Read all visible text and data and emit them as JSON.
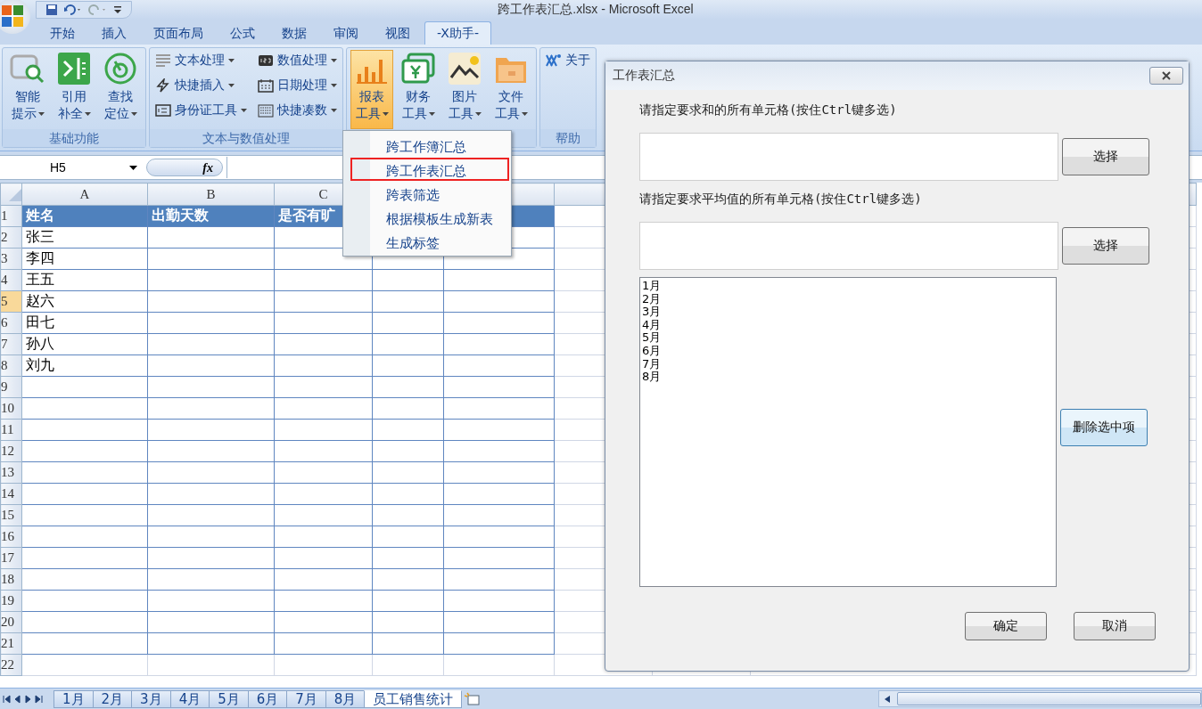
{
  "window": {
    "title": "跨工作表汇总.xlsx - Microsoft Excel"
  },
  "ribbon_tabs": [
    {
      "label": "开始",
      "selected": false
    },
    {
      "label": "插入",
      "selected": false
    },
    {
      "label": "页面布局",
      "selected": false
    },
    {
      "label": "公式",
      "selected": false
    },
    {
      "label": "数据",
      "selected": false
    },
    {
      "label": "审阅",
      "selected": false
    },
    {
      "label": "视图",
      "selected": false
    },
    {
      "label": "-X助手-",
      "selected": true
    }
  ],
  "ribbon_groups": [
    {
      "label": "基础功能",
      "kind": "large",
      "buttons": [
        {
          "line1": "智能",
          "line2": "提示",
          "active": false
        },
        {
          "line1": "引用",
          "line2": "补全",
          "active": false
        },
        {
          "line1": "查找",
          "line2": "定位",
          "active": false
        }
      ]
    },
    {
      "label": "文本与数值处理",
      "kind": "small",
      "buttons": [
        {
          "label": "文本处理",
          "dropdown": true
        },
        {
          "label": "快捷插入",
          "dropdown": true
        },
        {
          "label": "身份证工具",
          "dropdown": true
        },
        {
          "label": "数值处理",
          "dropdown": true
        },
        {
          "label": "日期处理",
          "dropdown": true
        },
        {
          "label": "快捷凑数",
          "dropdown": true
        }
      ]
    },
    {
      "kind": "large",
      "buttons": [
        {
          "line1": "报表",
          "line2": "工具",
          "active": true
        },
        {
          "line1": "财务",
          "line2": "工具",
          "active": false
        },
        {
          "line1": "图片",
          "line2": "工具",
          "active": false
        },
        {
          "line1": "文件",
          "line2": "工具",
          "active": false
        }
      ]
    },
    {
      "label": "帮助",
      "kind": "small",
      "buttons": [
        {
          "label": "关于",
          "dropdown": false
        }
      ]
    }
  ],
  "formula_bar": {
    "name_box": "H5",
    "function_label": "fx"
  },
  "sheet": {
    "columns": [
      {
        "label": "A"
      },
      {
        "label": "B"
      },
      {
        "label": "C"
      },
      {},
      {},
      {},
      {},
      {}
    ],
    "rows": [
      {
        "number": "1",
        "header": true,
        "selected": false,
        "cells": [
          "姓名",
          "出勤天数",
          "是否有旷"
        ]
      },
      {
        "number": "2",
        "header": false,
        "selected": false,
        "cells": [
          "张三"
        ]
      },
      {
        "number": "3",
        "header": false,
        "selected": false,
        "cells": [
          "李四"
        ]
      },
      {
        "number": "4",
        "header": false,
        "selected": false,
        "cells": [
          "王五"
        ]
      },
      {
        "number": "5",
        "header": false,
        "selected": true,
        "cells": [
          "赵六"
        ]
      },
      {
        "number": "6",
        "header": false,
        "selected": false,
        "cells": [
          "田七"
        ]
      },
      {
        "number": "7",
        "header": false,
        "selected": false,
        "cells": [
          "孙八"
        ]
      },
      {
        "number": "8",
        "header": false,
        "selected": false,
        "cells": [
          "刘九"
        ]
      },
      {
        "number": "9",
        "header": false,
        "selected": false
      },
      {
        "number": "10",
        "header": false,
        "selected": false
      },
      {
        "number": "11",
        "header": false,
        "selected": false
      },
      {
        "number": "12",
        "header": false,
        "selected": false
      },
      {
        "number": "13",
        "header": false,
        "selected": false
      },
      {
        "number": "14",
        "header": false,
        "selected": false
      },
      {
        "number": "15",
        "header": false,
        "selected": false
      },
      {
        "number": "16",
        "header": false,
        "selected": false
      },
      {
        "number": "17",
        "header": false,
        "selected": false
      },
      {
        "number": "18",
        "header": false,
        "selected": false
      },
      {
        "number": "19",
        "header": false,
        "selected": false
      },
      {
        "number": "20",
        "header": false,
        "selected": false
      },
      {
        "number": "21",
        "header": false,
        "selected": false
      },
      {
        "number": "22",
        "header": false,
        "selected": false
      }
    ]
  },
  "sheet_tabs": [
    {
      "label": "1月",
      "selected": false
    },
    {
      "label": "2月",
      "selected": false
    },
    {
      "label": "3月",
      "selected": false
    },
    {
      "label": "4月",
      "selected": false
    },
    {
      "label": "5月",
      "selected": false
    },
    {
      "label": "6月",
      "selected": false
    },
    {
      "label": "7月",
      "selected": false
    },
    {
      "label": "8月",
      "selected": false
    },
    {
      "label": "员工销售统计",
      "selected": true
    }
  ],
  "dropdown_menu": {
    "items": [
      {
        "label": "跨工作簿汇总",
        "selected": false
      },
      {
        "label": "跨工作表汇总",
        "selected": true
      },
      {
        "label": "跨表筛选",
        "selected": false
      },
      {
        "label": "根据模板生成新表",
        "selected": false
      },
      {
        "label": "生成标签",
        "selected": false
      }
    ]
  },
  "dialog": {
    "title": "工作表汇总",
    "sum_label": "请指定要求和的所有单元格(按住Ctrl键多选)",
    "sum_select": "选择",
    "avg_label": "请指定要求平均值的所有单元格(按住Ctrl键多选)",
    "avg_select": "选择",
    "sheet_list": [
      "1月",
      "2月",
      "3月",
      "4月",
      "5月",
      "6月",
      "7月",
      "8月"
    ],
    "delete_button": "删除选中项",
    "ok_button": "确定",
    "cancel_button": "取消"
  }
}
